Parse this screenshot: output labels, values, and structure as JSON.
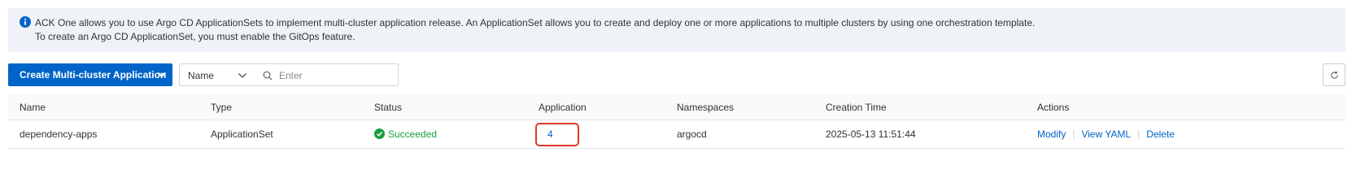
{
  "notice": {
    "icon": "info-icon",
    "line1": "ACK One allows you to use Argo CD ApplicationSets to implement multi-cluster application release. An ApplicationSet allows you to create and deploy one or more applications to multiple clusters by using one orchestration template.",
    "line2": "To create an Argo CD ApplicationSet, you must enable the GitOps feature."
  },
  "toolbar": {
    "create_label": "Create Multi-cluster Application",
    "filter_selected": "Name",
    "search_placeholder": "Enter",
    "refresh_icon": "refresh-icon"
  },
  "table": {
    "columns": {
      "name": "Name",
      "type": "Type",
      "status": "Status",
      "application": "Application",
      "namespaces": "Namespaces",
      "creation_time": "Creation Time",
      "actions": "Actions"
    },
    "rows": [
      {
        "name": "dependency-apps",
        "type": "ApplicationSet",
        "status": "Succeeded",
        "application": "4",
        "namespaces": "argocd",
        "creation_time": "2025-05-13 11:51:44",
        "actions": [
          "Modify",
          "View YAML",
          "Delete"
        ]
      }
    ]
  },
  "colors": {
    "primary": "#0064c8",
    "success": "#1b9e3e",
    "highlight": "#e0392b",
    "notice_bg": "#eff2f6"
  }
}
